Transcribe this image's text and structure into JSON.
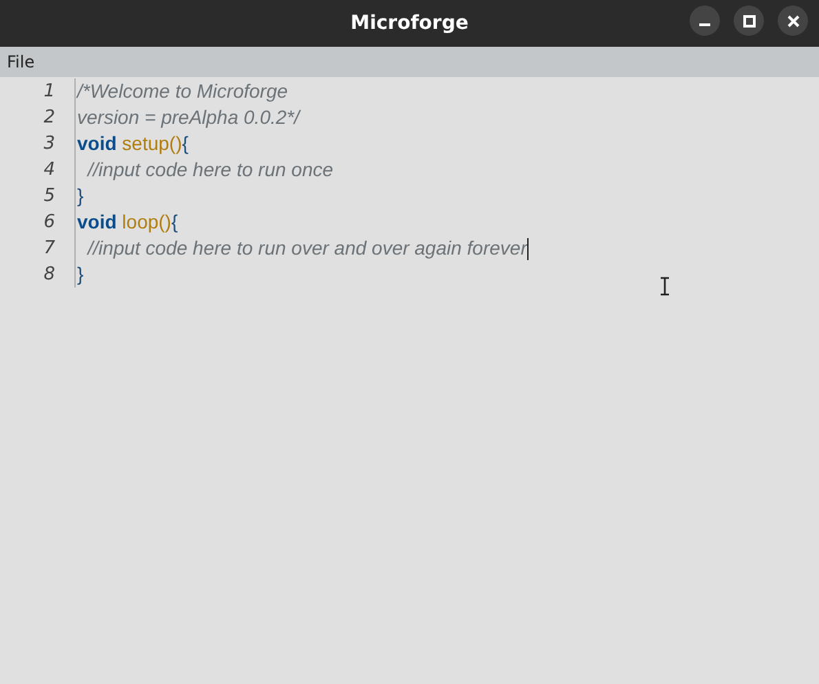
{
  "window": {
    "title": "Microforge"
  },
  "menu": [
    {
      "label": "File"
    }
  ],
  "editor": {
    "lines": [
      {
        "number": "1",
        "caret": false,
        "tokens": [
          {
            "kind": "comment",
            "text": "/*Welcome to Microforge"
          }
        ]
      },
      {
        "number": "2",
        "caret": false,
        "tokens": [
          {
            "kind": "comment",
            "text": "version = preAlpha 0.0.2*/"
          }
        ]
      },
      {
        "number": "3",
        "caret": false,
        "tokens": [
          {
            "kind": "keyword",
            "text": "void"
          },
          {
            "kind": "function",
            "text": " setup()"
          },
          {
            "kind": "brace",
            "text": "{"
          }
        ]
      },
      {
        "number": "4",
        "caret": false,
        "tokens": [
          {
            "kind": "comment",
            "text": "  //input code here to run once"
          }
        ]
      },
      {
        "number": "5",
        "caret": false,
        "tokens": [
          {
            "kind": "brace",
            "text": "}"
          }
        ]
      },
      {
        "number": "6",
        "caret": false,
        "tokens": [
          {
            "kind": "keyword",
            "text": "void"
          },
          {
            "kind": "function",
            "text": " loop()"
          },
          {
            "kind": "brace",
            "text": "{"
          }
        ]
      },
      {
        "number": "7",
        "caret": true,
        "tokens": [
          {
            "kind": "comment",
            "text": "  //input code here to run over and over again forever"
          }
        ]
      },
      {
        "number": "8",
        "caret": false,
        "tokens": [
          {
            "kind": "brace",
            "text": "}"
          }
        ]
      }
    ]
  }
}
